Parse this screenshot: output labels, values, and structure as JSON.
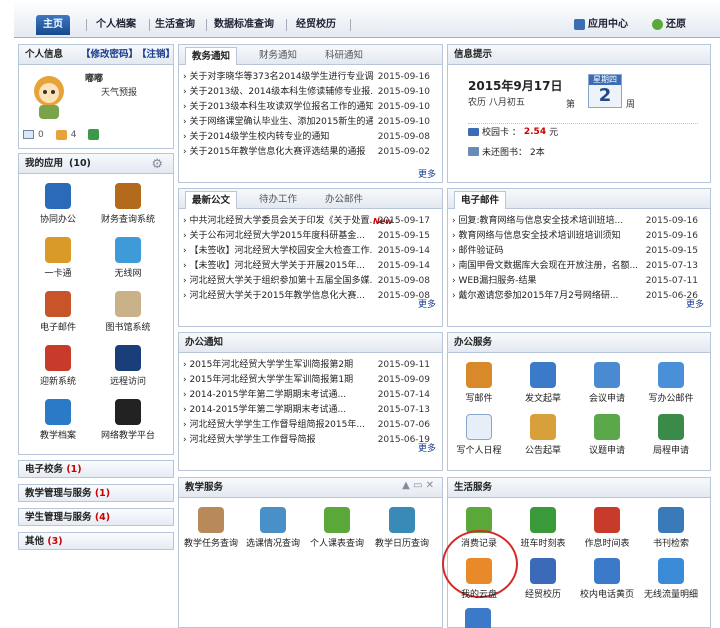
{
  "nav": {
    "tabs": [
      "主页",
      "个人档案",
      "生活查询",
      "数据标准查询",
      "经贸校历"
    ],
    "app_center": "应用中心",
    "restore": "还原"
  },
  "profile": {
    "title": "个人信息",
    "change_password": "【修改密码】",
    "logout": "【注销】",
    "name": "嘟嘟",
    "weather": "天气预报",
    "msg_count": "0",
    "notice_count": "4"
  },
  "myapps": {
    "title": "我的应用",
    "count": "(10)",
    "items": [
      "协同办公",
      "财务查询系统",
      "一卡通",
      "无线网",
      "电子邮件",
      "图书馆系统",
      "迎新系统",
      "远程访问",
      "教学档案",
      "网络教学平台"
    ]
  },
  "sidebar_sections": [
    {
      "label": "电子校务",
      "count": "(1)"
    },
    {
      "label": "教学管理与服务",
      "count": "(1)"
    },
    {
      "label": "学生管理与服务",
      "count": "(4)"
    },
    {
      "label": "其他",
      "count": "(3)"
    }
  ],
  "notices": {
    "tabs": [
      "教务通知",
      "财务通知",
      "科研通知"
    ],
    "rows": [
      {
        "t": "关于对李晓华等373名2014级学生进行专业调...",
        "d": "2015-09-16"
      },
      {
        "t": "关于2013级、2014级本科生修读辅修专业报...",
        "d": "2015-09-10"
      },
      {
        "t": "关于2013级本科生攻读双学位报名工作的通知",
        "d": "2015-09-10"
      },
      {
        "t": "关于网络课堂确认毕业生、添加2015新生的通知...",
        "d": "2015-09-10"
      },
      {
        "t": "关于2014级学生校内转专业的通知",
        "d": "2015-09-08"
      },
      {
        "t": "关于2015年教学信息化大赛评选结果的通报",
        "d": "2015-09-02"
      }
    ],
    "more": "更多"
  },
  "info": {
    "title": "信息提示",
    "date": "2015年9月17日",
    "lunar": "农历 八月初五",
    "week_label": "星期四",
    "week_prefix": "第",
    "week_num": "2",
    "week_suffix": "周",
    "card_label": "校园卡 ：",
    "card_value": "2.54",
    "card_unit": "元",
    "books_label": "未还图书：",
    "books_value": "2本"
  },
  "docs": {
    "tabs": [
      "最新公文",
      "待办工作",
      "办公邮件"
    ],
    "rows": [
      {
        "t": "中共河北经贸大学委员会关于印发《关于处置...",
        "new": "New",
        "d": "2015-09-17"
      },
      {
        "t": "关于公布河北经贸大学2015年度科研基金...",
        "d": "2015-09-15"
      },
      {
        "t": "【未签收】河北经贸大学校园安全大检查工作...",
        "d": "2015-09-14"
      },
      {
        "t": "【未签收】河北经贸大学关于开展2015年...",
        "d": "2015-09-14"
      },
      {
        "t": "河北经贸大学关于组织参加第十五届全国多媒...",
        "d": "2015-09-08"
      },
      {
        "t": "河北经贸大学关于2015年教学信息化大赛...",
        "d": "2015-09-08"
      }
    ],
    "more": "更多"
  },
  "mail": {
    "title": "电子邮件",
    "rows": [
      {
        "t": "回复:教育网络与信息安全技术培训班培...",
        "d": "2015-09-16"
      },
      {
        "t": "教育网络与信息安全技术培训班培训须知",
        "d": "2015-09-16"
      },
      {
        "t": "邮件验证码",
        "d": "2015-09-15"
      },
      {
        "t": "南国甲骨文数据库大会现在开放注册，名额...",
        "d": "2015-07-13"
      },
      {
        "t": "WEB漏扫服务-结果",
        "d": "2015-07-11"
      },
      {
        "t": "戴尔邀请您参加2015年7月2号网络研...",
        "d": "2015-06-26"
      }
    ],
    "more": "更多"
  },
  "office": {
    "title": "办公通知",
    "rows": [
      {
        "t": "2015年河北经贸大学学生军训简报第2期",
        "d": "2015-09-11"
      },
      {
        "t": "2015年河北经贸大学学生军训简报第1期",
        "d": "2015-09-09"
      },
      {
        "t": "2014-2015学年第二学期期末考试通...",
        "d": "2015-07-14"
      },
      {
        "t": "2014-2015学年第二学期期末考试通...",
        "d": "2015-07-13"
      },
      {
        "t": "河北经贸大学学生工作督导组简报2015年...",
        "d": "2015-07-06"
      },
      {
        "t": "河北经贸大学学生工作督导简报",
        "d": "2015-06-19"
      }
    ],
    "more": "更多"
  },
  "office_services": {
    "title": "办公服务",
    "items": [
      "写邮件",
      "发文起草",
      "会议申请",
      "写办公邮件",
      "写个人日程",
      "公告起草",
      "议题申请",
      "局程申请"
    ]
  },
  "teaching": {
    "title": "教学服务",
    "items": [
      "教学任务查询",
      "选课情况查询",
      "个人课表查询",
      "教学日历查询"
    ]
  },
  "life": {
    "title": "生活服务",
    "items": [
      "消费记录",
      "班车时刻表",
      "作息时间表",
      "书刊检索",
      "我的云盘",
      "经贸校历",
      "校内电话黄页",
      "无线流量明细"
    ]
  },
  "colors": {
    "accent": "#1f5aa8",
    "red": "#cc0000",
    "border": "#b7c6d8"
  }
}
